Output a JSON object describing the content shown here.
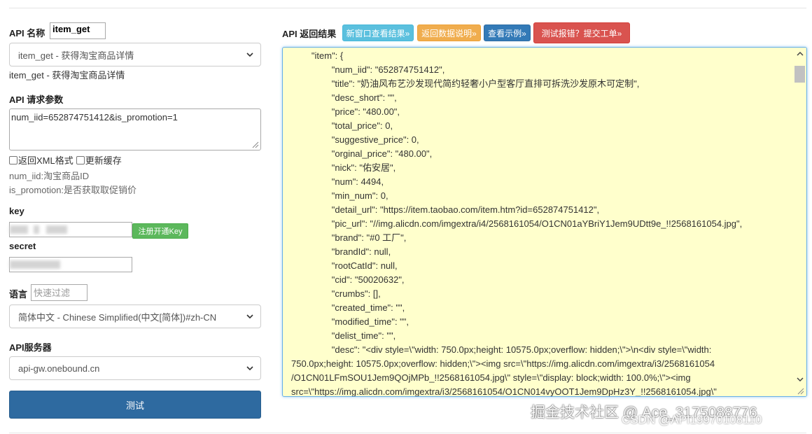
{
  "left": {
    "api_name_label": "API 名称",
    "api_name_value": "item_get",
    "api_select": "item_get - 获得淘宝商品详情",
    "api_desc": "item_get - 获得淘宝商品详情",
    "params_label": "API 请求参数",
    "params_value": "num_iid=652874751412&is_promotion=1",
    "xml_checkbox": "返回XML格式",
    "cache_checkbox": "更新缓存",
    "hint_1": "num_iid:淘宝商品ID",
    "hint_2": "is_promotion:是否获取取促销价",
    "key_label": "key",
    "register_button": "注册开通Key",
    "secret_label": "secret",
    "lang_label": "语言",
    "lang_filter_placeholder": "快速过滤",
    "lang_select": "简体中文 - Chinese Simplified(中文[简体])#zh-CN",
    "server_label": "API服务器",
    "server_select": "api-gw.onebound.cn",
    "test_button": "测试"
  },
  "right": {
    "result_label": "API 返回结果",
    "buttons": {
      "new_window": "新窗口查看结果»",
      "data_desc": "返回数据说明»",
      "example": "查看示例»",
      "report": "测试报错？提交工单»"
    },
    "result_lines": [
      "        \"item\": {",
      "                \"num_iid\": \"652874751412\",",
      "                \"title\": \"奶油风布艺沙发现代简约轻奢小户型客厅直排可拆洗沙发原木可定制\",",
      "                \"desc_short\": \"\",",
      "                \"price\": \"480.00\",",
      "                \"total_price\": 0,",
      "                \"suggestive_price\": 0,",
      "                \"orginal_price\": \"480.00\",",
      "                \"nick\": \"佑安居\",",
      "                \"num\": 4494,",
      "                \"min_num\": 0,",
      "                \"detail_url\": \"https://item.taobao.com/item.htm?id=652874751412\",",
      "                \"pic_url\": \"//img.alicdn.com/imgextra/i4/2568161054/O1CN01aYBriY1Jem9UDtt9e_!!2568161054.jpg\",",
      "                \"brand\": \"#0 工厂\",",
      "                \"brandId\": null,",
      "                \"rootCatId\": null,",
      "                \"cid\": \"50020632\",",
      "                \"crumbs\": [],",
      "                \"created_time\": \"\",",
      "                \"modified_time\": \"\",",
      "                \"delist_time\": \"\",",
      "                \"desc\": \"<div style=\\\"width: 750.0px;height: 10575.0px;overflow: hidden;\\\">\\n<div style=\\\"width:",
      "750.0px;height: 10575.0px;overflow: hidden;\\\"><img src=\\\"https://img.alicdn.com/imgextra/i3/2568161054",
      "/O1CN01LFmSOU1Jem9QOjMPb_!!2568161054.jpg\\\" style=\\\"display: block;width: 100.0%;\\\"><img",
      "src=\\\"https://img.alicdn.com/imgextra/i3/2568161054/O1CN014vyOOT1Jem9DpHz3Y_!!2568161054.jpg\\\""
    ]
  },
  "watermarks": {
    "main": "掘金技术社区 @ Ace_3175088776",
    "sub": "CSDN @API19970108110"
  },
  "colors": {
    "test_button": "#2e6aa0",
    "result_bg": "#ffffcc",
    "register_green": "#5cb85c",
    "info": "#5bc0de",
    "warning": "#f0ad4e",
    "primary": "#337ab7",
    "danger": "#d9534f"
  },
  "icons": [
    "chevron-down-icon",
    "resize-grip-icon",
    "scroll-up-icon",
    "scroll-down-icon"
  ]
}
